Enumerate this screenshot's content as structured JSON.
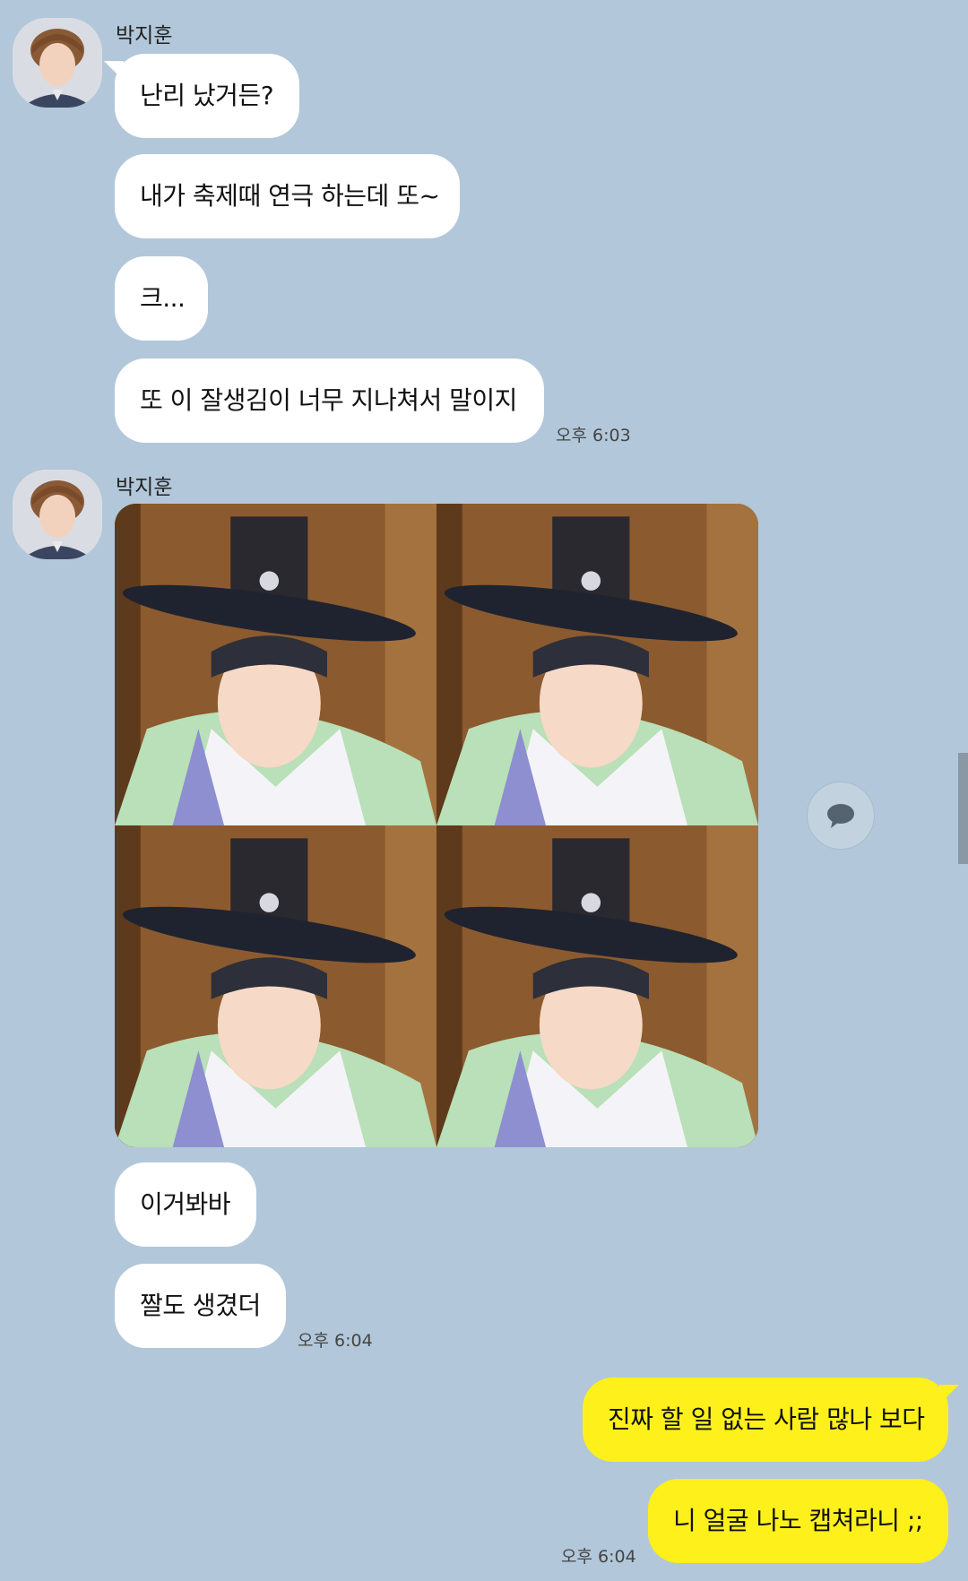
{
  "colors": {
    "background": "#b2c7d9",
    "incoming_bubble": "#ffffff",
    "outgoing_bubble": "#fef01b"
  },
  "groups": [
    {
      "sender": "박지훈",
      "messages": [
        "난리 났거든?",
        "내가 축제때 연극 하는데 또~",
        "크...",
        "또 이 잘생김이 너무 지나쳐서 말이지"
      ],
      "time": "오후 6:03"
    },
    {
      "sender": "박지훈",
      "image": {
        "tiles": 4,
        "icon": "image-grid"
      },
      "messages": [
        "이거봐바",
        "짤도 생겼더"
      ],
      "time": "오후 6:04"
    }
  ],
  "outgoing": {
    "messages": [
      "진짜 할 일 없는 사람 많나 보다",
      "니 얼굴 나노 캡쳐라니 ;;"
    ],
    "time": "오후 6:04"
  },
  "share_button": {
    "icon": "speech-bubble-icon"
  }
}
